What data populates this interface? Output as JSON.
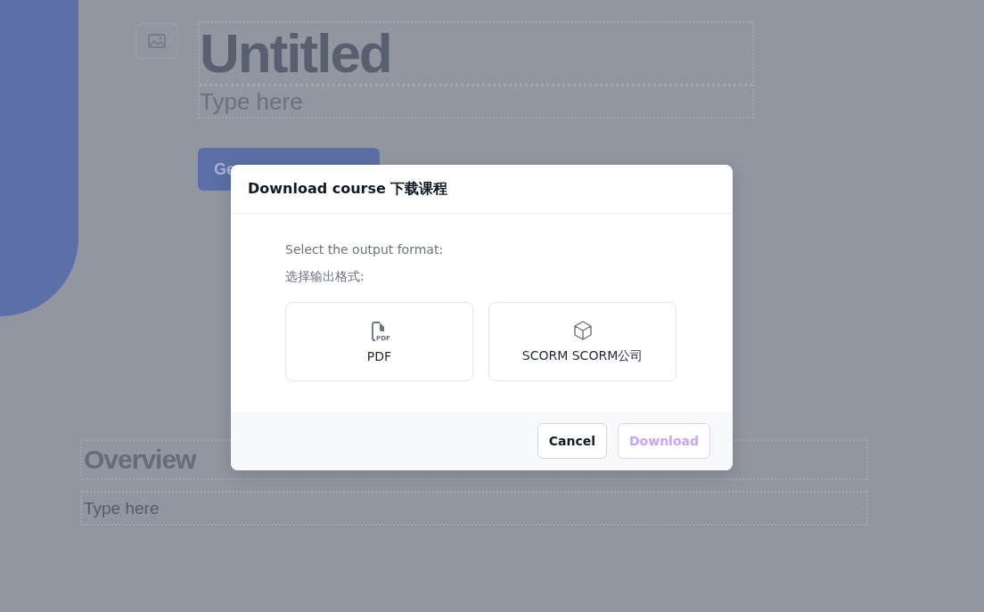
{
  "page": {
    "title": "Untitled",
    "subtitle_placeholder": "Type here",
    "button_label": "Ge",
    "sections": [
      {
        "heading": "Overview",
        "placeholder": "Type here"
      }
    ]
  },
  "dialog": {
    "title": "Download course 下载课程",
    "prompt": [
      "Select the output format:",
      "选择输出格式:"
    ],
    "options": [
      {
        "label": "PDF",
        "kind": "pdf",
        "icon_text": "PDF"
      },
      {
        "label": "SCORM SCORM公司",
        "kind": "package"
      }
    ],
    "buttons": [
      {
        "label": "Cancel",
        "kind": "secondary",
        "disabled": false
      },
      {
        "label": "Download",
        "kind": "primary",
        "disabled": true
      }
    ]
  }
}
